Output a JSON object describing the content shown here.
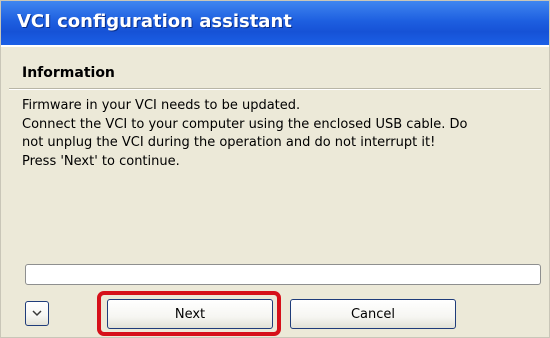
{
  "window": {
    "title": "VCI configuration assistant"
  },
  "content": {
    "heading": "Information",
    "lines": [
      "Firmware in your VCI needs to be updated.",
      "Connect the VCI to your computer using the enclosed USB cable. Do",
      "not unplug the VCI during the operation and do not interrupt it!",
      "Press 'Next' to continue."
    ]
  },
  "progress": {
    "value_percent": 0
  },
  "buttons": {
    "expand_icon": "chevron-down-icon",
    "next_label": "Next",
    "cancel_label": "Cancel"
  },
  "colors": {
    "titlebar": "#1e5fe0",
    "highlight": "#d6101a"
  }
}
